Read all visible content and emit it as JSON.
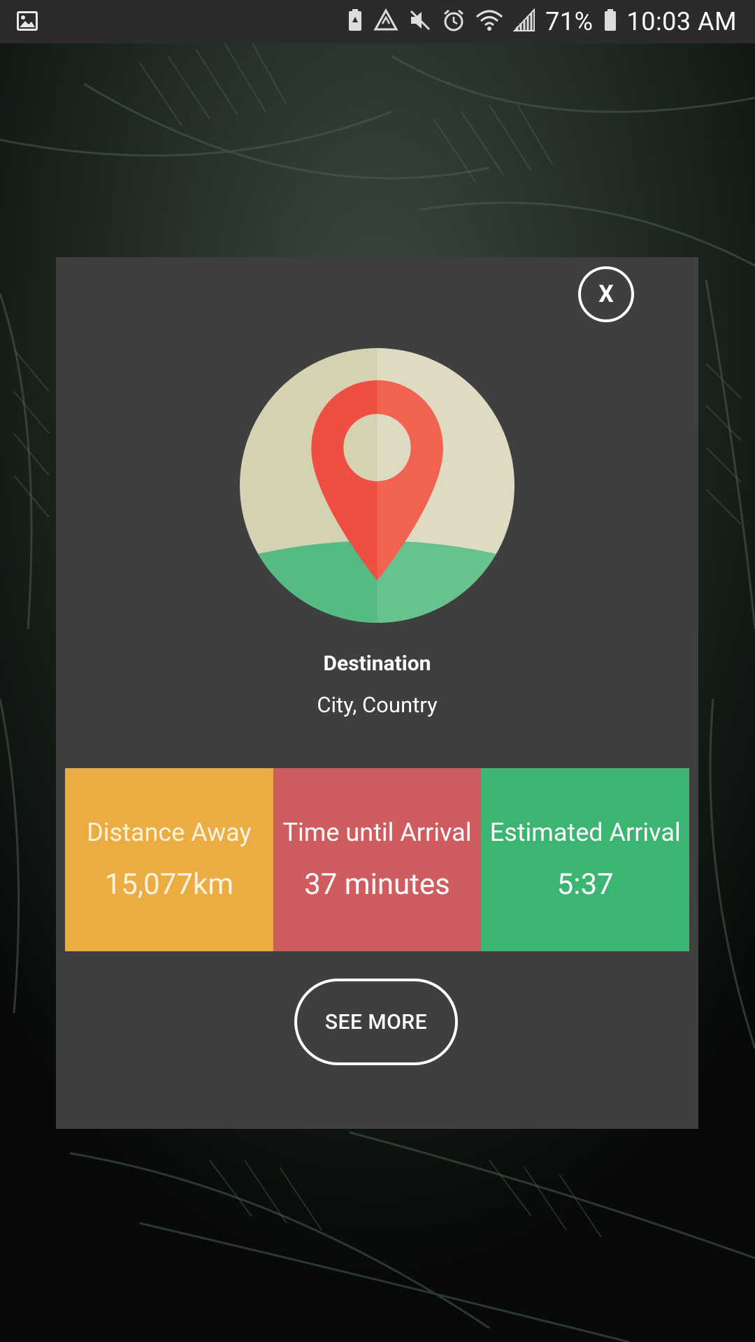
{
  "status_bar": {
    "battery_percent": "71%",
    "time": "10:03 AM",
    "icons": [
      "gallery-icon",
      "battery-saver-icon",
      "recycle-icon",
      "mute-icon",
      "alarm-icon",
      "wifi-icon",
      "signal-icon",
      "battery-icon"
    ]
  },
  "modal": {
    "close_label": "X",
    "illustration": "location-pin-icon",
    "destination_title": "Destination",
    "destination_subtitle": "City, Country",
    "stats": [
      {
        "label": "Distance Away",
        "value": "15,077km",
        "color": "#ebad43"
      },
      {
        "label": "Time until Arrival",
        "value": "37 minutes",
        "color": "#cf5c5e"
      },
      {
        "label": "Estimated Arrival",
        "value": "5:37",
        "color": "#3db572"
      }
    ],
    "see_more_label": "SEE MORE"
  }
}
